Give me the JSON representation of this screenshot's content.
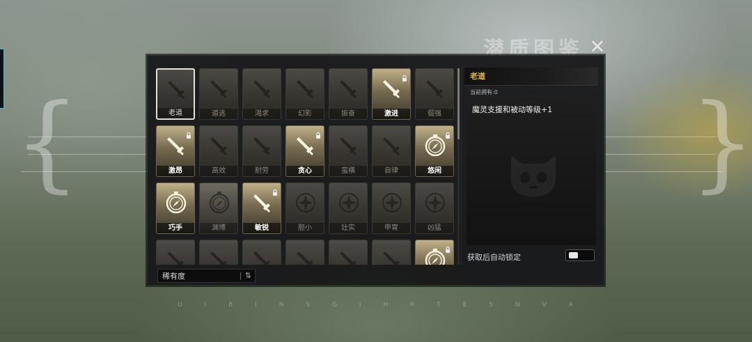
{
  "background": {
    "title": "潜质图鉴",
    "letters": [
      "U",
      "I",
      "B",
      "I",
      "N",
      "S",
      "G",
      "I",
      "H",
      "R",
      "T",
      "E",
      "S",
      "N",
      "V",
      "A"
    ]
  },
  "close": {
    "label": "×"
  },
  "grid": {
    "cards": [
      {
        "name": "老道",
        "icon": "sword-icon",
        "rarity": "selected",
        "locked": false
      },
      {
        "name": "遁逃",
        "icon": "sword-icon",
        "rarity": "common",
        "locked": false
      },
      {
        "name": "渴求",
        "icon": "sword-icon",
        "rarity": "common",
        "locked": false
      },
      {
        "name": "幻影",
        "icon": "sword-icon",
        "rarity": "common",
        "locked": false
      },
      {
        "name": "振奋",
        "icon": "sword-icon",
        "rarity": "common",
        "locked": false
      },
      {
        "name": "激进",
        "icon": "sword-icon",
        "rarity": "gold",
        "locked": true
      },
      {
        "name": "倔强",
        "icon": "sword-icon",
        "rarity": "common",
        "locked": false
      },
      {
        "name": "激昂",
        "icon": "sword-icon",
        "rarity": "gold",
        "locked": true
      },
      {
        "name": "高效",
        "icon": "sword-icon",
        "rarity": "common",
        "locked": false
      },
      {
        "name": "耐劳",
        "icon": "sword-icon",
        "rarity": "common",
        "locked": false
      },
      {
        "name": "贪心",
        "icon": "sword-icon",
        "rarity": "gold",
        "locked": true
      },
      {
        "name": "蛮横",
        "icon": "sword-icon",
        "rarity": "common",
        "locked": false
      },
      {
        "name": "自律",
        "icon": "sword-icon",
        "rarity": "common",
        "locked": false
      },
      {
        "name": "悠闲",
        "icon": "compass-icon",
        "rarity": "gold",
        "locked": true
      },
      {
        "name": "巧手",
        "icon": "compass-icon",
        "rarity": "gold",
        "locked": false
      },
      {
        "name": "渊博",
        "icon": "compass-icon",
        "rarity": "brown",
        "locked": false
      },
      {
        "name": "敏锐",
        "icon": "sword-icon",
        "rarity": "gold",
        "locked": true
      },
      {
        "name": "胆小",
        "icon": "star-emblem-icon",
        "rarity": "common",
        "locked": false
      },
      {
        "name": "壮实",
        "icon": "star-emblem-icon",
        "rarity": "common",
        "locked": false
      },
      {
        "name": "甲胄",
        "icon": "star-emblem-icon",
        "rarity": "common",
        "locked": false
      },
      {
        "name": "凶猛",
        "icon": "star-emblem-icon",
        "rarity": "common",
        "locked": false
      },
      {
        "name": "",
        "icon": "sword-icon",
        "rarity": "common",
        "locked": false
      },
      {
        "name": "",
        "icon": "sword-icon",
        "rarity": "common",
        "locked": false
      },
      {
        "name": "",
        "icon": "sword-icon",
        "rarity": "common",
        "locked": false
      },
      {
        "name": "",
        "icon": "sword-icon",
        "rarity": "common",
        "locked": false
      },
      {
        "name": "",
        "icon": "sword-icon",
        "rarity": "common",
        "locked": false
      },
      {
        "name": "",
        "icon": "sword-icon",
        "rarity": "common",
        "locked": false
      },
      {
        "name": "",
        "icon": "compass-icon",
        "rarity": "gold",
        "locked": true
      }
    ]
  },
  "sort": {
    "label": "稀有度",
    "icon": "sort-arrows-icon"
  },
  "detail": {
    "title": "老道",
    "owned": "当前拥有:0",
    "description": "魔灵支援和被动等级+1",
    "auto_lock_label": "获取后自动锁定"
  },
  "colors": {
    "accent_gold": "#e0b84a",
    "tab_cyan": "#46b9d6"
  }
}
